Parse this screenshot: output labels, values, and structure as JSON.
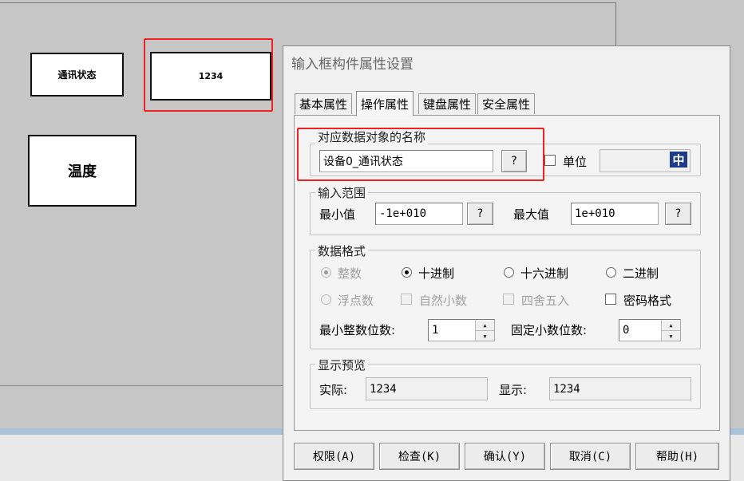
{
  "canvas": {
    "widgets": {
      "comm_status_label": "通讯状态",
      "value_box": "1234",
      "temperature_label": "温度"
    }
  },
  "dialog": {
    "title": "输入框构件属性设置",
    "tabs": [
      "基本属性",
      "操作属性",
      "键盘属性",
      "安全属性"
    ],
    "active_tab": "操作属性",
    "data_object": {
      "group_label": "对应数据对象的名称",
      "value": "设备0_通讯状态",
      "browse_label": "?",
      "unit_label": "单位",
      "unit_checked": false,
      "ime_indicator": "中"
    },
    "input_range": {
      "group_label": "输入范围",
      "min_label": "最小值",
      "min_value": "-1e+010",
      "max_label": "最大值",
      "max_value": "1e+010",
      "browse_label": "?"
    },
    "data_format": {
      "group_label": "数据格式",
      "integer": "整数",
      "decimal": "十进制",
      "hex": "十六进制",
      "binary": "二进制",
      "float": "浮点数",
      "natural_decimal": "自然小数",
      "round": "四舍五入",
      "password": "密码格式",
      "min_int_digits_label": "最小整数位数:",
      "min_int_digits_value": "1",
      "fixed_decimal_label": "固定小数位数:",
      "fixed_decimal_value": "0"
    },
    "preview": {
      "group_label": "显示预览",
      "actual_label": "实际:",
      "actual_value": "1234",
      "display_label": "显示:",
      "display_value": "1234"
    },
    "buttons": {
      "permission": "权限(A)",
      "check": "检查(K)",
      "confirm": "确认(Y)",
      "cancel": "取消(C)",
      "help": "帮助(H)"
    }
  },
  "colors": {
    "highlight": "#e22222",
    "ime_bg": "#1e3a8a"
  }
}
